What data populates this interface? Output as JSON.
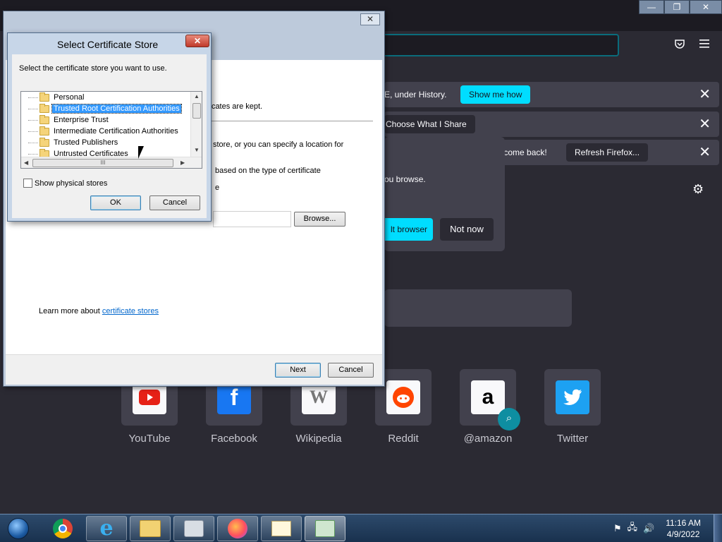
{
  "firefox": {
    "window_controls": [
      "—",
      "❐",
      "✕"
    ],
    "notification_bars": [
      {
        "text": "E, under History.",
        "button": "Show me how"
      },
      {
        "text": "",
        "button": "Choose What I Share"
      },
      {
        "text": "elcome back!",
        "button": "Refresh Firefox..."
      }
    ],
    "welcome_text": "ou browse.",
    "default_browser_button": "lt browser",
    "not_now_button": "Not now",
    "top_sites": [
      {
        "label": "YouTube",
        "icon": "youtube-icon",
        "color": "#e62117"
      },
      {
        "label": "Facebook",
        "icon": "facebook-icon",
        "color": "#1877f2"
      },
      {
        "label": "Wikipedia",
        "icon": "wikipedia-icon",
        "color": "#888888"
      },
      {
        "label": "Reddit",
        "icon": "reddit-icon",
        "color": "#ff4500"
      },
      {
        "label": "@amazon",
        "icon": "amazon-icon",
        "color": "#000000"
      },
      {
        "label": "Twitter",
        "icon": "twitter-icon",
        "color": "#1da1f2"
      }
    ]
  },
  "wizard": {
    "close": "✕",
    "text_kept": "ificates are kept.",
    "text_store_line1": "store, or you can specify a location for",
    "text_type_line1": "based on the type of certificate",
    "text_type_line2": "e",
    "browse_button": "Browse...",
    "learn_more_prefix": "Learn more about ",
    "learn_more_link": "certificate stores",
    "next_button": "Next",
    "cancel_button": "Cancel"
  },
  "store_dialog": {
    "title": "Select Certificate Store",
    "close": "✕",
    "instruction": "Select the certificate store you want to use.",
    "stores": [
      {
        "label": "Personal",
        "selected": false
      },
      {
        "label": "Trusted Root Certification Authorities",
        "selected": true
      },
      {
        "label": "Enterprise Trust",
        "selected": false
      },
      {
        "label": "Intermediate Certification Authorities",
        "selected": false
      },
      {
        "label": "Trusted Publishers",
        "selected": false
      },
      {
        "label": "Untrusted Certificates",
        "selected": false
      }
    ],
    "hscroll_grip": "III",
    "show_physical_label": "Show physical stores",
    "ok_button": "OK",
    "cancel_button": "Cancel"
  },
  "taskbar": {
    "apps": [
      "chrome",
      "internet-explorer",
      "file-explorer",
      "app-4",
      "firefox",
      "certificate-manager",
      "certificate-import-wizard"
    ],
    "time": "11:16 AM",
    "date": "4/9/2022"
  }
}
